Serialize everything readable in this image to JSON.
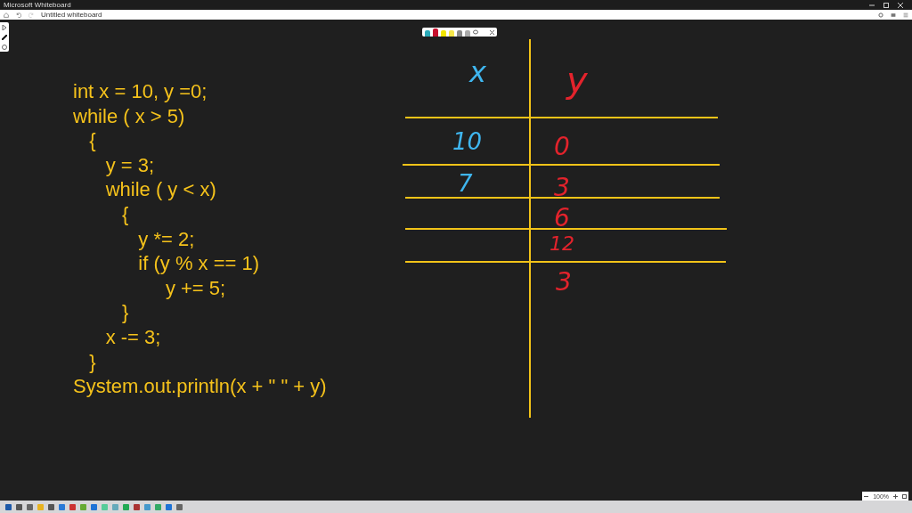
{
  "window": {
    "title": "Microsoft Whiteboard"
  },
  "app_bar": {
    "board_title": "Untitled whiteboard"
  },
  "code": {
    "color": "#f5c21b",
    "lines": [
      "int x = 10, y =0;",
      "while ( x > 5)",
      "   {",
      "      y = 3;",
      "      while ( y < x)",
      "         {",
      "            y *= 2;",
      "            if (y % x == 1)",
      "                 y += 5;",
      "         }",
      "      x -= 3;",
      "   }",
      "System.out.println(x + \" \" + y)"
    ]
  },
  "table": {
    "headers": [
      {
        "text": "x",
        "color": "#3fb6ef"
      },
      {
        "text": "y",
        "color": "#e3232c"
      }
    ],
    "x_values": [
      {
        "text": "10",
        "color": "#3fb6ef"
      },
      {
        "text": "7",
        "color": "#3fb6ef"
      }
    ],
    "y_values": [
      {
        "text": "0",
        "color": "#e3232c"
      },
      {
        "text": "3",
        "color": "#e3232c"
      },
      {
        "text": "6",
        "color": "#e3232c"
      },
      {
        "text": "12",
        "color": "#e3232c"
      },
      {
        "text": "3",
        "color": "#e3232c"
      }
    ]
  },
  "pens": [
    {
      "color": "#2aa9b8",
      "selected": false
    },
    {
      "color": "#c8102e",
      "selected": true
    },
    {
      "color": "#f2e600",
      "selected": false
    },
    {
      "color": "#f5e64a",
      "selected": false
    }
  ],
  "zoom": {
    "value": "100%"
  }
}
